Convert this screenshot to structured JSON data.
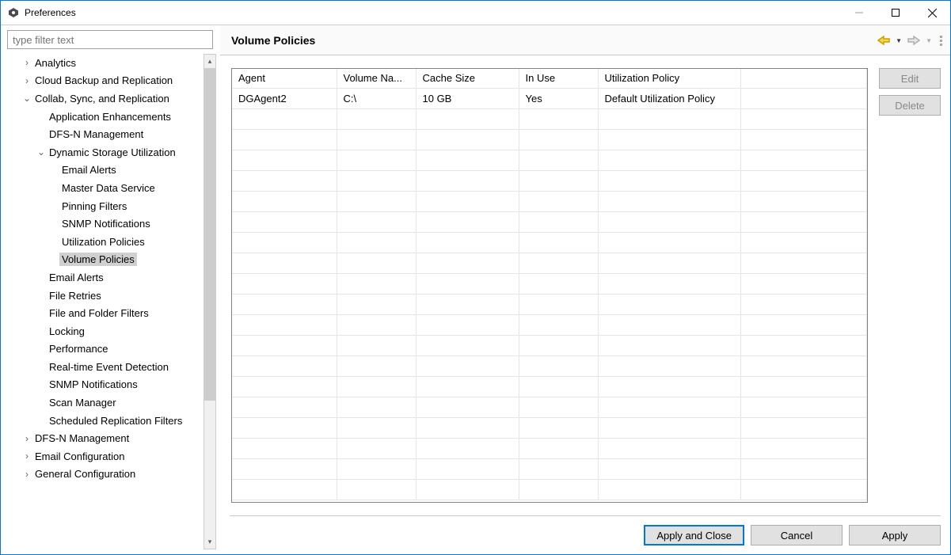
{
  "window": {
    "title": "Preferences"
  },
  "filter": {
    "placeholder": "type filter text"
  },
  "tree": {
    "n0": "Analytics",
    "n1": "Cloud Backup and Replication",
    "n2": "Collab, Sync, and Replication",
    "n3": "Application Enhancements",
    "n4": "DFS-N Management",
    "n5": "Dynamic Storage Utilization",
    "n6": "Email Alerts",
    "n7": "Master Data Service",
    "n8": "Pinning Filters",
    "n9": "SNMP Notifications",
    "n10": "Utilization Policies",
    "n11": "Volume Policies",
    "n12": "Email Alerts",
    "n13": "File Retries",
    "n14": "File and Folder Filters",
    "n15": "Locking",
    "n16": "Performance",
    "n17": "Real-time Event Detection",
    "n18": "SNMP Notifications",
    "n19": "Scan Manager",
    "n20": "Scheduled Replication Filters",
    "n21": "DFS-N Management",
    "n22": "Email Configuration",
    "n23": "General Configuration"
  },
  "page": {
    "title": "Volume Policies"
  },
  "table": {
    "headers": {
      "agent": "Agent",
      "volume": "Volume Na...",
      "cache": "Cache Size",
      "inuse": "In Use",
      "policy": "Utilization Policy"
    },
    "row0": {
      "agent": "DGAgent2",
      "volume": "C:\\",
      "cache": "10 GB",
      "inuse": "Yes",
      "policy": "Default Utilization Policy"
    }
  },
  "buttons": {
    "edit": "Edit",
    "delete": "Delete",
    "applyClose": "Apply and Close",
    "cancel": "Cancel",
    "apply": "Apply"
  }
}
